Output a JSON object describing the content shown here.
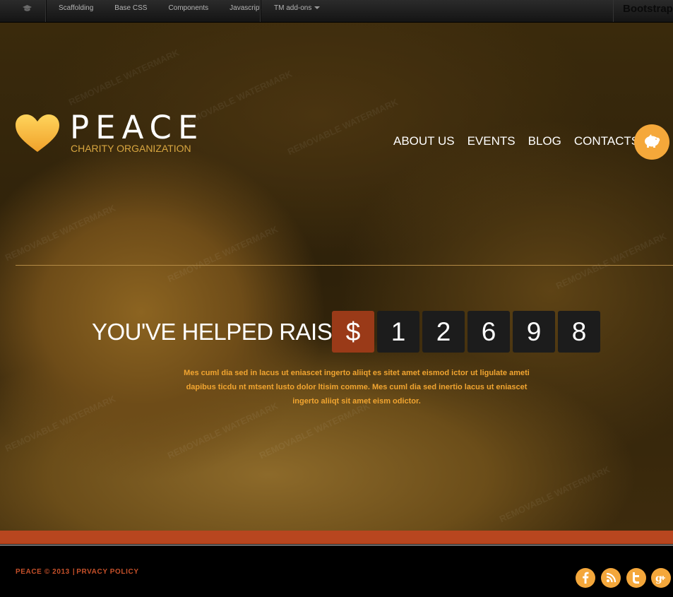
{
  "topbar": {
    "links": [
      "Scaffolding",
      "Base CSS",
      "Components",
      "Javascript"
    ],
    "addons_label": "TM add-ons",
    "brand": "Bootstrap"
  },
  "logo": {
    "title": "PEACE",
    "subtitle": "CHARITY ORGANIZATION"
  },
  "nav": {
    "items": [
      "ABOUT US",
      "EVENTS",
      "BLOG",
      "CONTACTS"
    ]
  },
  "hero": {
    "raise_label": "YOU'VE HELPED RAISE:",
    "currency": "$",
    "digits": [
      "1",
      "2",
      "6",
      "9",
      "8"
    ],
    "description": "Mes cuml dia sed in lacus ut eniascet ingerto aliiqt es sitet amet eismod ictor ut ligulate ameti dapibus ticdu nt mtsent lusto dolor ltisim comme. Mes cuml dia sed inertio lacus ut eniascet ingerto aliiqt sit amet eism odictor.",
    "watermark": "REMOVABLE WATERMARK"
  },
  "footer": {
    "copyright": "PEACE © 2013",
    "privacy": "PRVACY POLICY",
    "social_icons": [
      "facebook-icon",
      "rss-icon",
      "twitter-icon",
      "google-plus-icon"
    ]
  },
  "colors": {
    "accent": "#f4a73b",
    "stripe": "#b8461f",
    "tile": "#1c1c1c",
    "dollar_tile": "#9a3a18"
  }
}
